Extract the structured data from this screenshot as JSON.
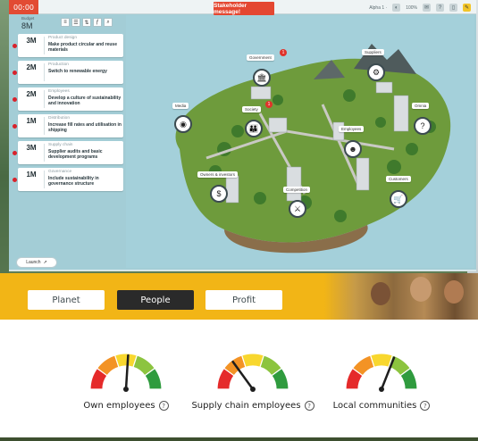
{
  "topbar": {
    "timer": "00:00",
    "stakeholder_message": "Stakeholder message!",
    "user": "Alpha 1 ·",
    "zoom": "100%"
  },
  "sidebar": {
    "budget_label": "Budget",
    "budget_value": "8M",
    "launch_label": "Launch",
    "cards": [
      {
        "amount": "3M",
        "category": "Product design",
        "description": "Make product circular and reuse materials"
      },
      {
        "amount": "2M",
        "category": "Production",
        "description": "Switch to renewable energy"
      },
      {
        "amount": "2M",
        "category": "Employees",
        "description": "Develop a culture of sustainability and innovation"
      },
      {
        "amount": "1M",
        "category": "Distribution",
        "description": "Increase fill rates and utilisation in shipping"
      },
      {
        "amount": "3M",
        "category": "Supply chain",
        "description": "Supplier audits and basic development programs"
      },
      {
        "amount": "1M",
        "category": "Governance",
        "description": "Include sustainability in governance structure"
      }
    ]
  },
  "map": {
    "labels": {
      "government": "Government",
      "suppliers": "Suppliers",
      "media": "Media",
      "society": "Society",
      "omnia": "Omnia",
      "employees": "Employees",
      "owners": "Owners & investors",
      "competition": "Competition",
      "customers": "Customers"
    },
    "badge_count": "1"
  },
  "stakeholder_panel": {
    "tabs": [
      "Planet",
      "People",
      "Profit"
    ],
    "active_tab": "People",
    "gauges": [
      {
        "label": "Own employees",
        "level": 0.52
      },
      {
        "label": "Supply chain employees",
        "level": 0.3
      },
      {
        "label": "Local communities",
        "level": 0.62
      }
    ]
  },
  "colors": {
    "accent_yellow": "#f2b516",
    "alert_red": "#e44731",
    "gauge_red": "#e52a2a",
    "gauge_orange": "#f39325",
    "gauge_yellow": "#f8d72e",
    "gauge_lightgreen": "#8cc43f",
    "gauge_green": "#2f9b3e"
  }
}
